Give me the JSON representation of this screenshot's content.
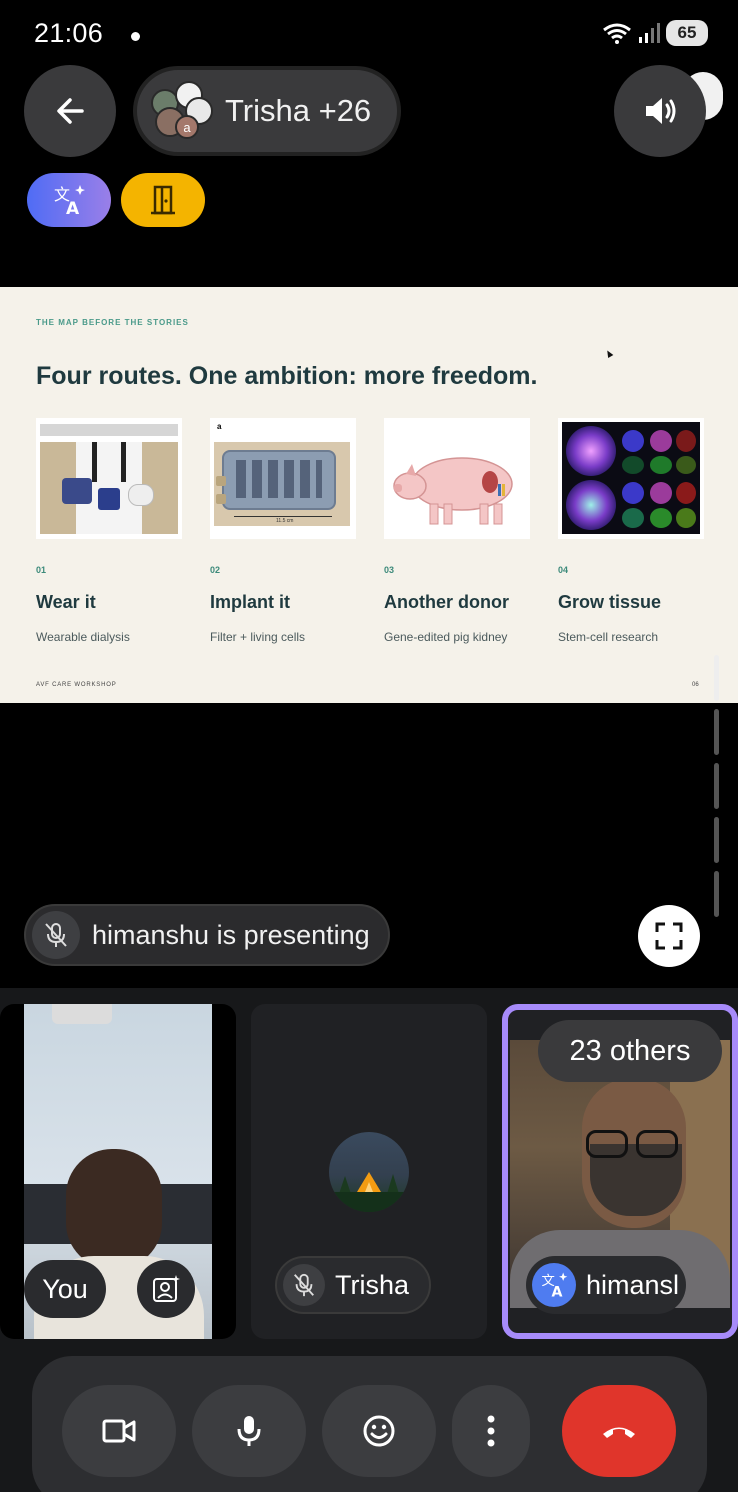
{
  "status_bar": {
    "time": "21:06",
    "battery": "65"
  },
  "header": {
    "title": "Trisha +26",
    "avatar_initial": "a"
  },
  "slide": {
    "kicker": "THE MAP BEFORE THE STORIES",
    "title": "Four routes. One ambition: more freedom.",
    "cards": [
      {
        "num": "01",
        "title": "Wear it",
        "sub": "Wearable dialysis"
      },
      {
        "num": "02",
        "title": "Implant it",
        "sub": "Filter + living cells",
        "image_label": "a",
        "image_caption": "11.5 cm"
      },
      {
        "num": "03",
        "title": "Another donor",
        "sub": "Gene-edited pig kidney"
      },
      {
        "num": "04",
        "title": "Grow tissue",
        "sub": "Stem-cell research"
      }
    ],
    "footer": "AVF CARE WORKSHOP",
    "page": "06"
  },
  "presenting": {
    "text": "himanshu is presenting"
  },
  "tiles": {
    "you": {
      "name": "You"
    },
    "trisha": {
      "name": "Trisha"
    },
    "himanshu": {
      "name": "himansl",
      "others": "23 others"
    }
  },
  "colors": {
    "accent": "#a78bfa",
    "end_call": "#e0352b",
    "door_chip": "#f4b400"
  }
}
